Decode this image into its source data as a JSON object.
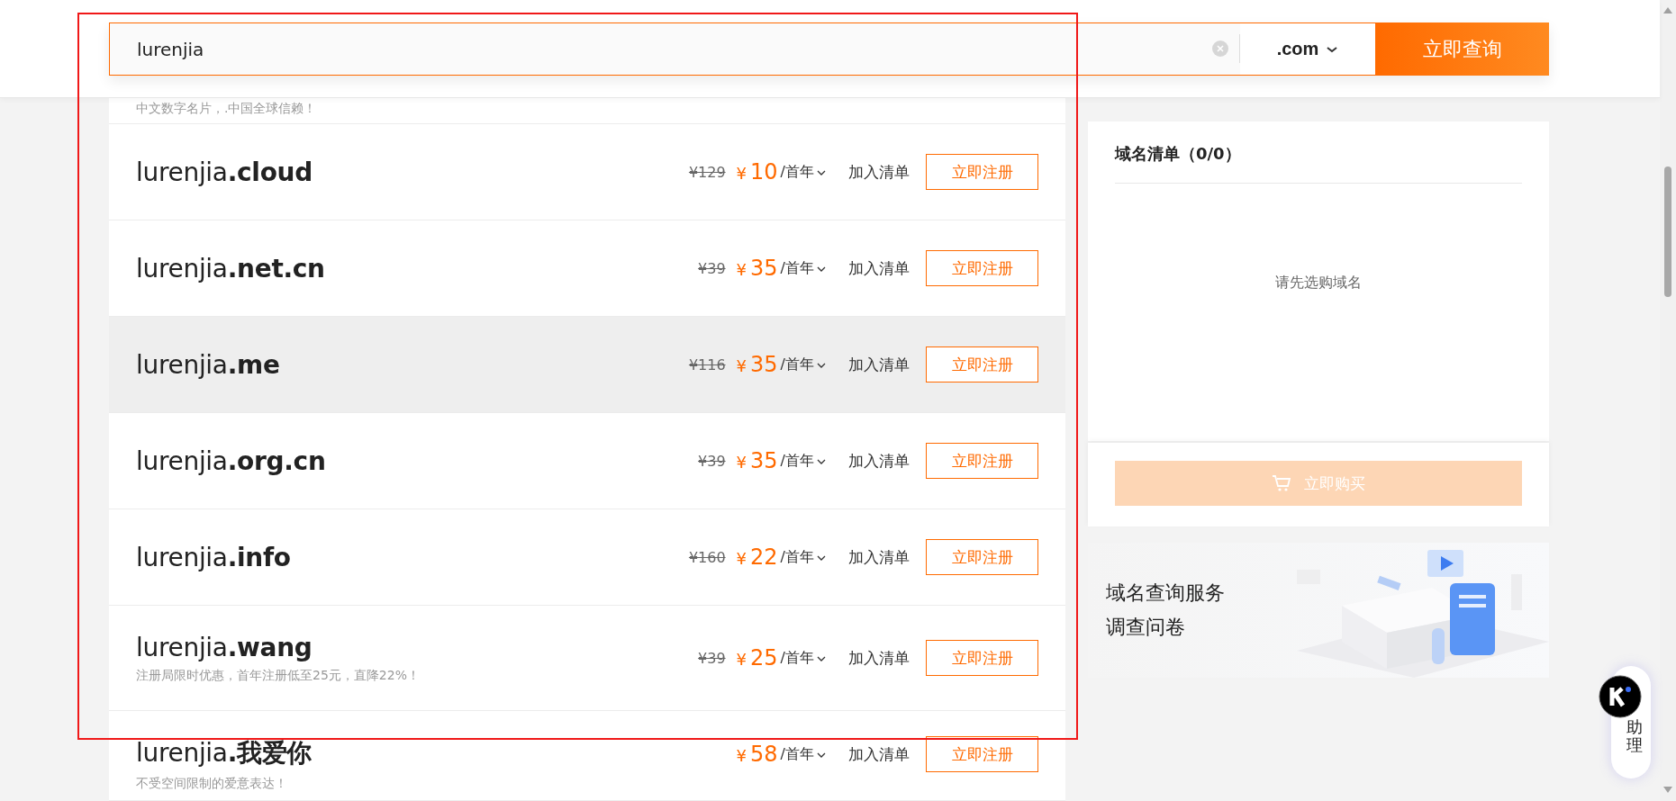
{
  "search": {
    "value": "lurenjia",
    "suffix": ".com",
    "submit": "立即查询"
  },
  "partial_row": {
    "description": "中文数字名片，.中国全球信赖！"
  },
  "rows": [
    {
      "name": "lurenjia",
      "suffix": ".cloud",
      "original_price": "¥129",
      "currency": "¥",
      "price": "10",
      "unit": "/首年",
      "add": "加入清单",
      "register": "立即注册",
      "highlighted": false
    },
    {
      "name": "lurenjia",
      "suffix": ".net.cn",
      "original_price": "¥39",
      "currency": "¥",
      "price": "35",
      "unit": "/首年",
      "add": "加入清单",
      "register": "立即注册",
      "highlighted": false
    },
    {
      "name": "lurenjia",
      "suffix": ".me",
      "original_price": "¥116",
      "currency": "¥",
      "price": "35",
      "unit": "/首年",
      "add": "加入清单",
      "register": "立即注册",
      "highlighted": true
    },
    {
      "name": "lurenjia",
      "suffix": ".org.cn",
      "original_price": "¥39",
      "currency": "¥",
      "price": "35",
      "unit": "/首年",
      "add": "加入清单",
      "register": "立即注册",
      "highlighted": false
    },
    {
      "name": "lurenjia",
      "suffix": ".info",
      "original_price": "¥160",
      "currency": "¥",
      "price": "22",
      "unit": "/首年",
      "add": "加入清单",
      "register": "立即注册",
      "highlighted": false
    },
    {
      "name": "lurenjia",
      "suffix": ".wang",
      "description": "注册局限时优惠，首年注册低至25元，直降22%！",
      "original_price": "¥39",
      "currency": "¥",
      "price": "25",
      "unit": "/首年",
      "add": "加入清单",
      "register": "立即注册",
      "highlighted": false
    },
    {
      "name": "lurenjia",
      "suffix": ".我爱你",
      "description": "不受空间限制的爱意表达！",
      "currency": "¥",
      "price": "58",
      "unit": "/首年",
      "add": "加入清单",
      "register": "立即注册",
      "highlighted": false
    }
  ],
  "cart": {
    "title": "域名清单（0/0）",
    "empty": "请先选购域名",
    "buy": "立即购买",
    "buy_disabled": true
  },
  "banner": {
    "lines": [
      "域名查询服务",
      "调查问卷"
    ]
  },
  "assistant": {
    "label": "助理"
  }
}
